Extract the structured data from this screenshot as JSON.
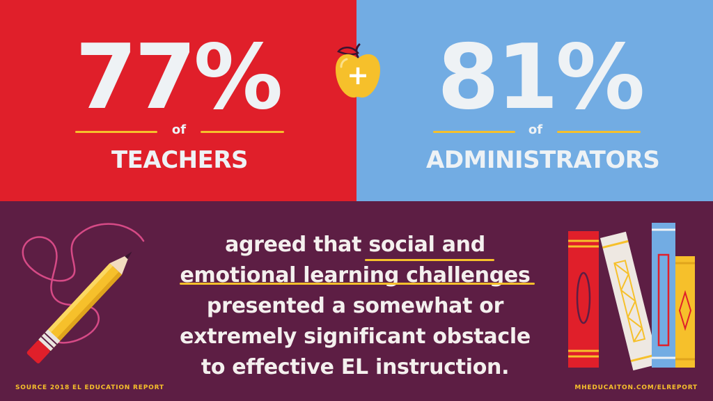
{
  "left": {
    "stat": "77%",
    "of": "of",
    "group": "TEACHERS"
  },
  "right": {
    "stat": "81%",
    "of": "of",
    "group": "ADMINISTRATORS"
  },
  "center_icon": {
    "symbol": "+",
    "icon": "apple-icon"
  },
  "body": {
    "line1_pre": "agreed that ",
    "line1_hl": "social and",
    "line2": "emotional learning challenges",
    "line3": "presented a somewhat or",
    "line4": "extremely significant obstacle",
    "line5": "to effective EL instruction."
  },
  "footer": {
    "source": "SOURCE 2018 EL EDUCATION REPORT",
    "site": "MHEDUCAITON.COM/ELREPORT"
  },
  "colors": {
    "red": "#e01f2a",
    "blue": "#72ace3",
    "plum": "#5d1e44",
    "yellow": "#f6c02b",
    "white": "#eef2f5"
  },
  "decorations": [
    "pencil-icon",
    "books-icon"
  ]
}
